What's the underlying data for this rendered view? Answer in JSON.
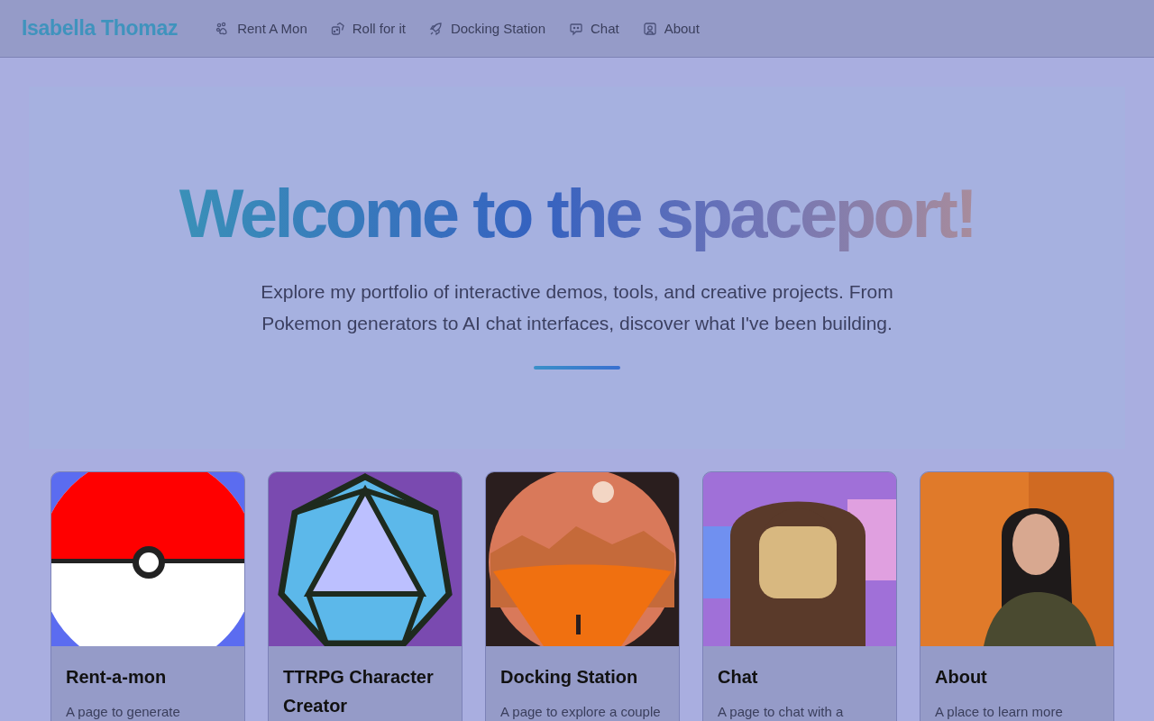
{
  "brand": "Isabella Thomaz",
  "nav": [
    {
      "label": "Rent A Mon",
      "kind": "paw"
    },
    {
      "label": "Roll for it",
      "kind": "dice"
    },
    {
      "label": "Docking Station",
      "kind": "rocket"
    },
    {
      "label": "Chat",
      "kind": "bot"
    },
    {
      "label": "About",
      "kind": "user"
    }
  ],
  "hero": {
    "title": "Welcome to the spaceport!",
    "subtitle": "Explore my portfolio of interactive demos, tools, and creative projects. From Pokemon generators to AI chat interfaces, discover what I've been building."
  },
  "cards": [
    {
      "title": "Rent-a-mon",
      "description": "A page to generate"
    },
    {
      "title": "TTRPG Character Creator"
    },
    {
      "title": "Docking Station",
      "description": "A page to explore a couple"
    },
    {
      "title": "Chat",
      "description": "A page to chat with a"
    },
    {
      "title": "About",
      "description": "A place to learn more"
    }
  ]
}
